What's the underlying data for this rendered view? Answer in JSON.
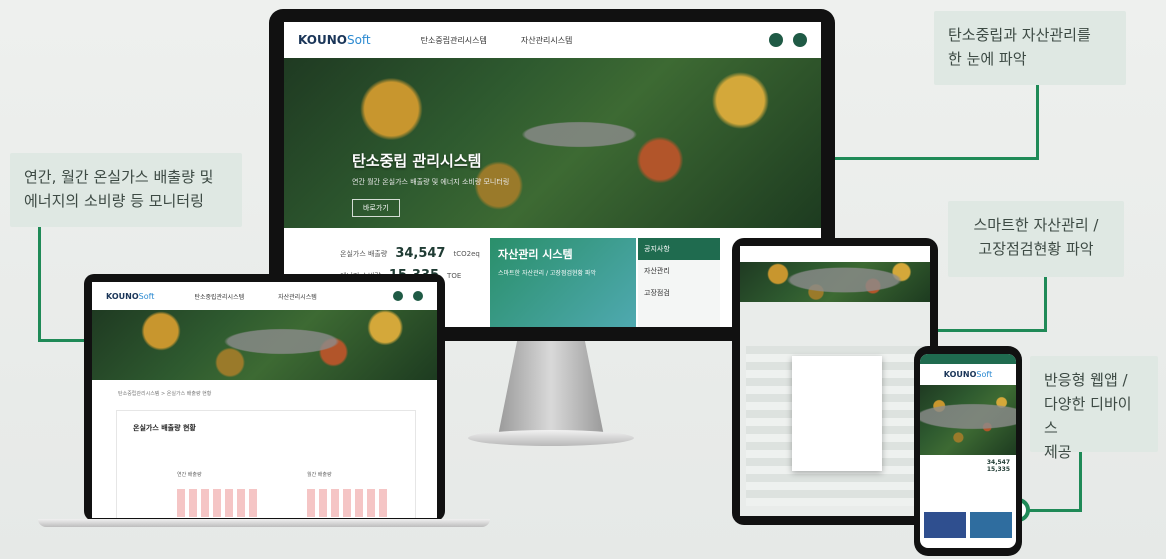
{
  "callouts": {
    "top_right": [
      "탄소중립과 자산관리를",
      "한 눈에 파악"
    ],
    "left": [
      "연간, 월간 온실가스 배출량 및",
      "에너지의 소비량 등 모니터링"
    ],
    "mid_right": [
      "스마트한  자산관리 /",
      "고장점검현황 파악"
    ],
    "bottom_right": [
      "반응형 웹앱 /",
      "다양한 디바이스",
      "제공"
    ]
  },
  "brand": {
    "logo_main": "KOUNO",
    "logo_sub": "Soft"
  },
  "monitor": {
    "nav": [
      "탄소중립관리시스템",
      "자산관리시스템"
    ],
    "hero_title": "탄소중립 관리시스템",
    "hero_sub": "연간 월간 온실가스 배출량 및 에너지 소비량 모니터링",
    "hero_button": "바로가기",
    "stats": [
      {
        "label": "온실가스 배출량",
        "value": "34,547",
        "unit": "tCO2eq"
      },
      {
        "label": "에너지 소비량",
        "value": "15,335",
        "unit": "TOE"
      }
    ],
    "card_title": "자산관리 시스템",
    "card_sub": "스마트한 자산관리 / 고장점검현황 파악",
    "side_panel": [
      "공지사항",
      "자산관리",
      "고장점검"
    ]
  },
  "laptop": {
    "nav": [
      "탄소중립관리시스템",
      "자산관리시스템"
    ],
    "breadcrumb": "탄소중립관리시스템 > 온실가스 배출량 현황",
    "section_title": "온실가스 배출량 현황",
    "chart_labels": [
      "연간 배출량",
      "월간 배출량"
    ]
  },
  "phone": {
    "stats": [
      {
        "value": "34,547"
      },
      {
        "value": "15,335"
      }
    ]
  },
  "colors": {
    "accent": "#1f8a57",
    "callout_bg": "#dfe8e3",
    "brand": "#1a3558"
  }
}
